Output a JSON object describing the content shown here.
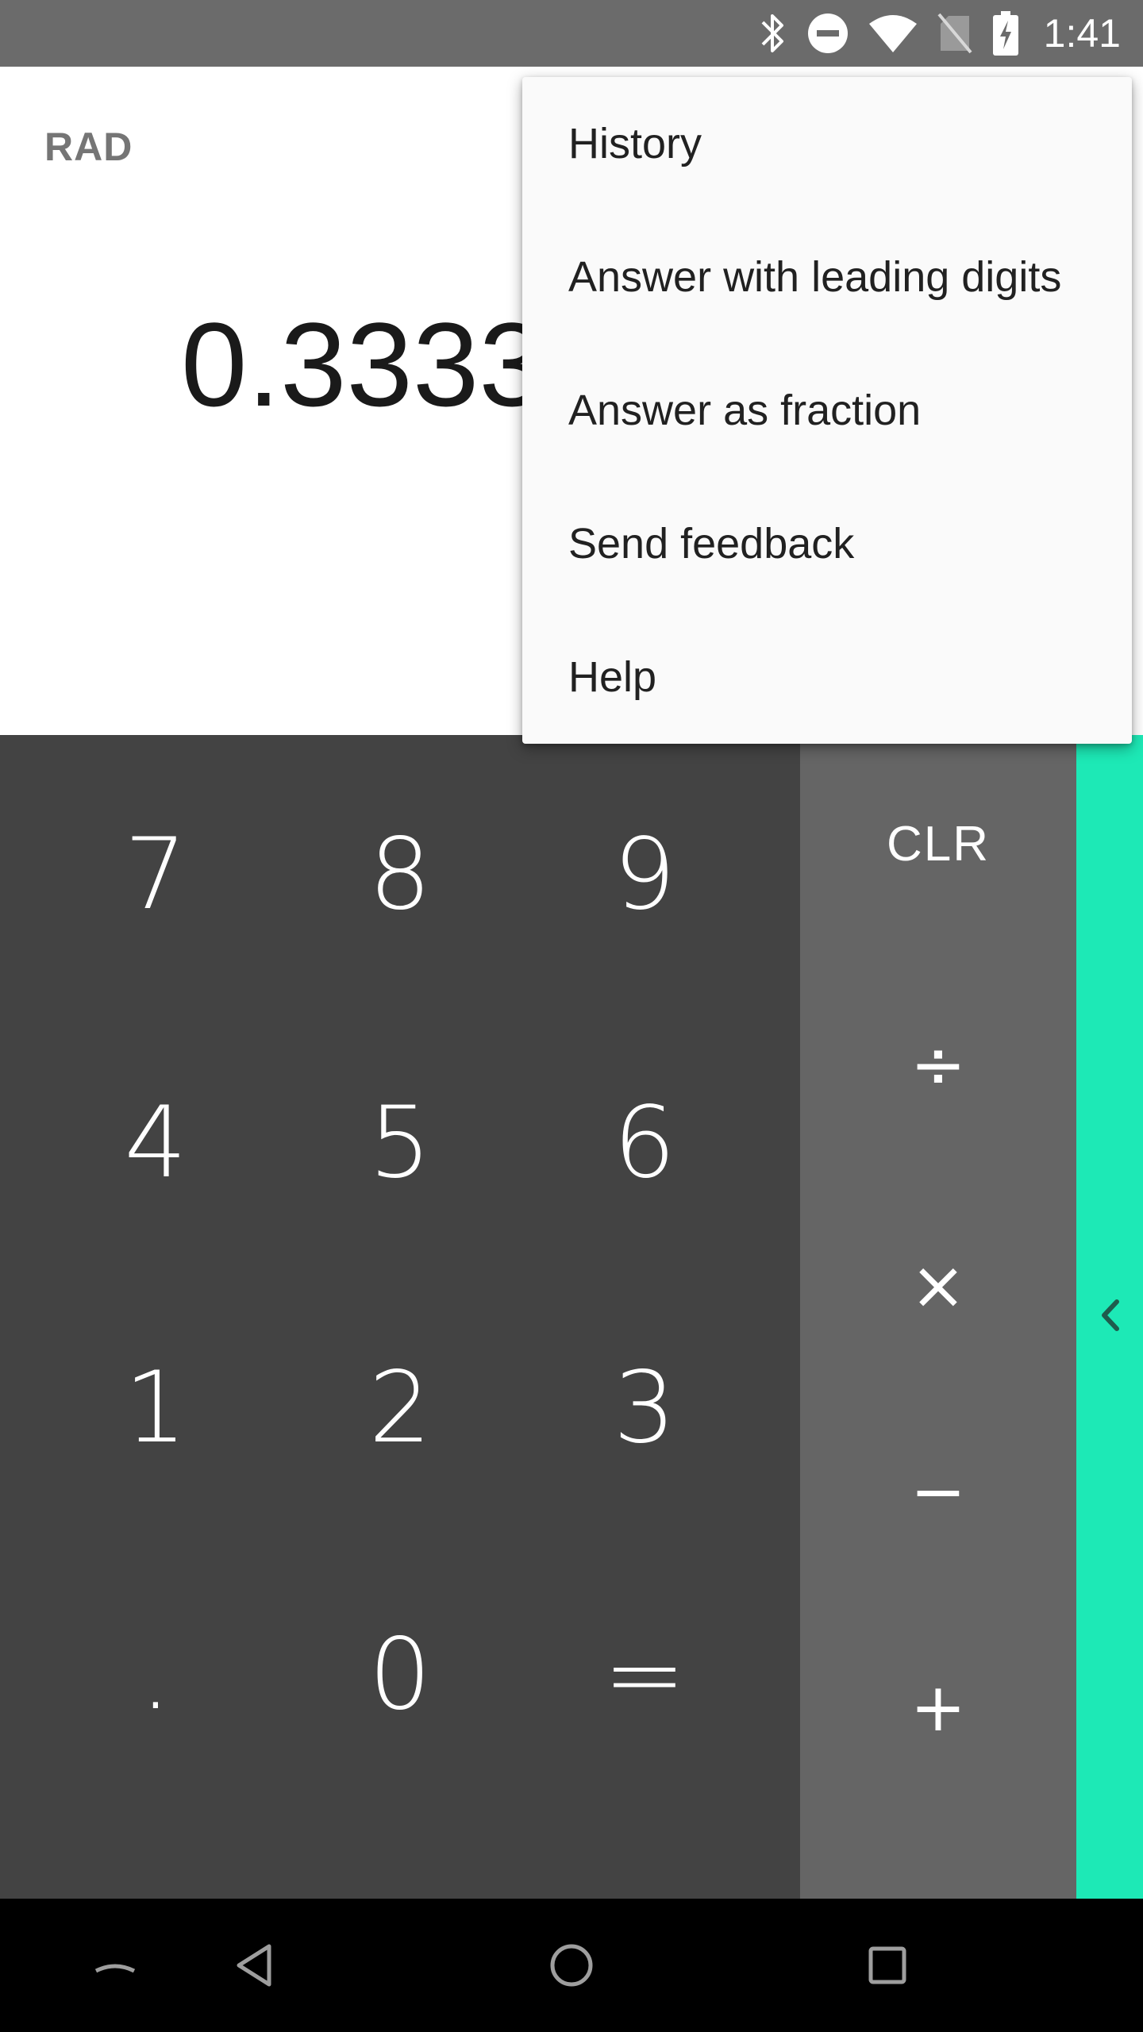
{
  "status_bar": {
    "time": "1:41",
    "icons": [
      "bluetooth-icon",
      "do-not-disturb-icon",
      "wifi-icon",
      "no-sim-icon",
      "battery-charging-icon"
    ]
  },
  "display": {
    "mode": "RAD",
    "result": "0.3333"
  },
  "keypad": {
    "digits": [
      "7",
      "8",
      "9",
      "4",
      "5",
      "6",
      "1",
      "2",
      "3",
      ".",
      "0",
      "="
    ]
  },
  "operators": {
    "clear": "CLR",
    "divide": "÷",
    "multiply": "×",
    "subtract": "−",
    "add": "+"
  },
  "advanced_panel": {
    "icon": "chevron-left-icon",
    "color": "#1de9b6"
  },
  "overflow_menu": {
    "items": [
      "History",
      "Answer with leading digits",
      "Answer as fraction",
      "Send feedback",
      "Help"
    ]
  },
  "nav_bar": {
    "icons": [
      "keyboard-hide-icon",
      "back-icon",
      "home-icon",
      "recents-icon"
    ]
  }
}
